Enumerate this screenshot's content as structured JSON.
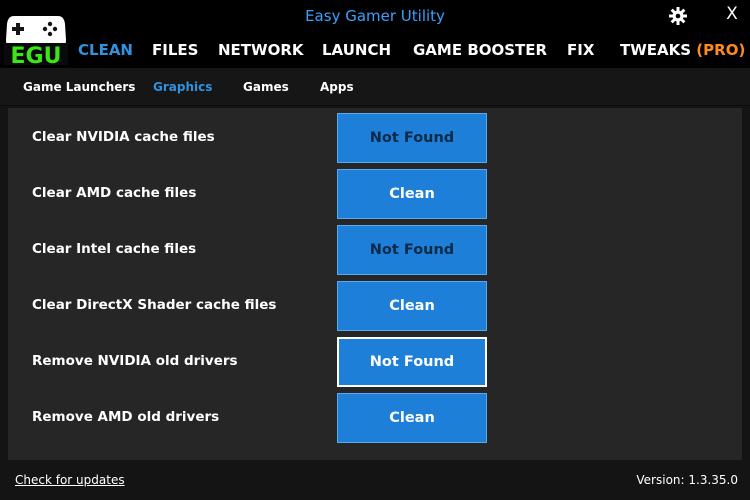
{
  "window": {
    "title": "Easy Gamer Utility"
  },
  "logo": {
    "text": "EGU",
    "text_color": "#39e616",
    "body_color": "#ffffff"
  },
  "main_nav": [
    {
      "label": "CLEAN",
      "active": true
    },
    {
      "label": "FILES",
      "active": false
    },
    {
      "label": "NETWORK",
      "active": false
    },
    {
      "label": "LAUNCH",
      "active": false
    },
    {
      "label": "GAME BOOSTER",
      "active": false
    },
    {
      "label": "FIX",
      "active": false
    },
    {
      "label": "TWEAKS",
      "active": false,
      "badge": "(PRO)"
    }
  ],
  "sub_nav": [
    {
      "label": "Game Launchers",
      "active": false
    },
    {
      "label": "Graphics",
      "active": true
    },
    {
      "label": "Games",
      "active": false
    },
    {
      "label": "Apps",
      "active": false
    }
  ],
  "rows": [
    {
      "label": "Clear NVIDIA cache files",
      "button": "Not Found"
    },
    {
      "label": "Clear AMD cache files",
      "button": "Clean"
    },
    {
      "label": "Clear Intel cache files",
      "button": "Not Found"
    },
    {
      "label": "Clear DirectX Shader cache files",
      "button": "Clean"
    },
    {
      "label": "Remove NVIDIA old drivers",
      "button": "Not Found"
    },
    {
      "label": "Remove AMD old drivers",
      "button": "Clean"
    }
  ],
  "footer": {
    "update_link": "Check for updates",
    "version": "Version: 1.3.35.0"
  },
  "colors": {
    "accent": "#2f93e0",
    "button": "#1e7fd8",
    "pro": "#ff8a1f",
    "background": "#141414",
    "panel": "#262626"
  }
}
